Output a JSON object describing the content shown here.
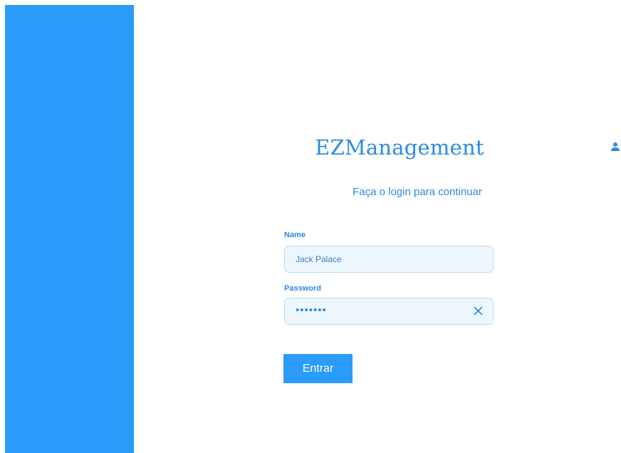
{
  "app": {
    "title": "EZManagement",
    "subtitle": "Faça o login para continuar"
  },
  "header": {
    "user_icon": "user-icon"
  },
  "form": {
    "name_label": "Name",
    "name_value": "Jack Palace",
    "password_label": "Password",
    "password_masked": "•••••••",
    "clear_icon": "close-icon",
    "submit_label": "Entrar"
  },
  "colors": {
    "sidebar": "#2b9bfc",
    "accent": "#2b8ae0",
    "field_background": "#eef6fd",
    "field_border": "#b9dcf7"
  }
}
